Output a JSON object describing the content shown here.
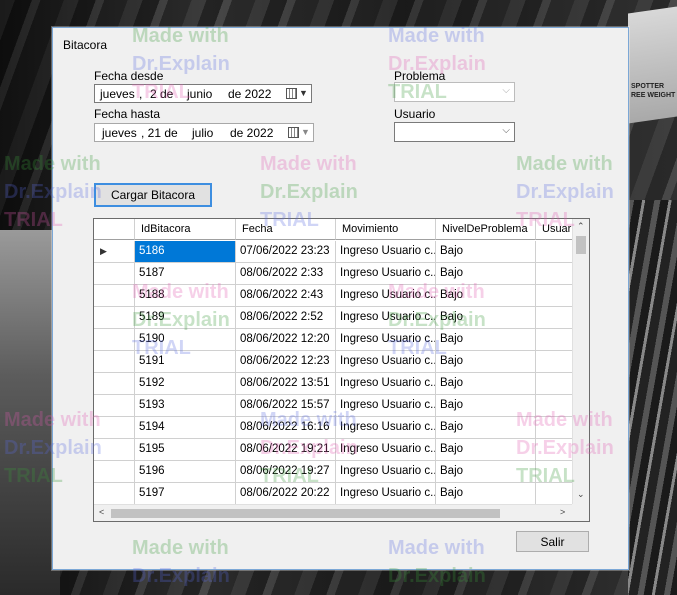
{
  "window": {
    "title": "Bitacora"
  },
  "filters": {
    "fecha_desde_label": "Fecha desde",
    "fecha_desde": {
      "weekday": "jueves",
      "day": "2 de",
      "month": "junio",
      "year": "de 2022"
    },
    "fecha_hasta_label": "Fecha hasta",
    "fecha_hasta": {
      "weekday": "jueves",
      "day": ", 21 de",
      "month": "julio",
      "year": "de 2022"
    },
    "problema_label": "Problema",
    "problema_value": "",
    "usuario_label": "Usuario",
    "usuario_value": ""
  },
  "buttons": {
    "cargar": "Cargar Bitacora",
    "salir": "Salir"
  },
  "grid": {
    "columns": [
      "IdBitacora",
      "Fecha",
      "Movimiento",
      "NivelDeProblema",
      "Usuario"
    ],
    "selected_row": 0,
    "rows": [
      [
        "5186",
        "07/06/2022 23:23",
        "Ingreso Usuario c...",
        "Bajo",
        ""
      ],
      [
        "5187",
        "08/06/2022 2:33",
        "Ingreso Usuario c...",
        "Bajo",
        ""
      ],
      [
        "5188",
        "08/06/2022 2:43",
        "Ingreso Usuario c...",
        "Bajo",
        ""
      ],
      [
        "5189",
        "08/06/2022 2:52",
        "Ingreso Usuario c...",
        "Bajo",
        ""
      ],
      [
        "5190",
        "08/06/2022 12:20",
        "Ingreso Usuario c...",
        "Bajo",
        ""
      ],
      [
        "5191",
        "08/06/2022 12:23",
        "Ingreso Usuario c...",
        "Bajo",
        ""
      ],
      [
        "5192",
        "08/06/2022 13:51",
        "Ingreso Usuario c...",
        "Bajo",
        ""
      ],
      [
        "5193",
        "08/06/2022 15:57",
        "Ingreso Usuario c...",
        "Bajo",
        ""
      ],
      [
        "5194",
        "08/06/2022 16:16",
        "Ingreso Usuario c...",
        "Bajo",
        ""
      ],
      [
        "5195",
        "08/06/2022 19:21",
        "Ingreso Usuario c...",
        "Bajo",
        ""
      ],
      [
        "5196",
        "08/06/2022 19:27",
        "Ingreso Usuario c...",
        "Bajo",
        ""
      ],
      [
        "5197",
        "08/06/2022 20:22",
        "Ingreso Usuario c...",
        "Bajo",
        ""
      ]
    ]
  },
  "watermark": {
    "line1": "Made with",
    "line2": "Dr.Explain",
    "line3": "TRIAL"
  },
  "background_sign": {
    "text": "SPOTTER\nREE WEIGHT"
  },
  "icons": {
    "calendar": "calendar-icon",
    "dropdown": "chevron-down-icon",
    "row_pointer": "row-pointer-icon"
  },
  "colors": {
    "selection": "#0078d7",
    "focus_border": "#3d8ee0",
    "window_bg": "#f0f0f0"
  }
}
